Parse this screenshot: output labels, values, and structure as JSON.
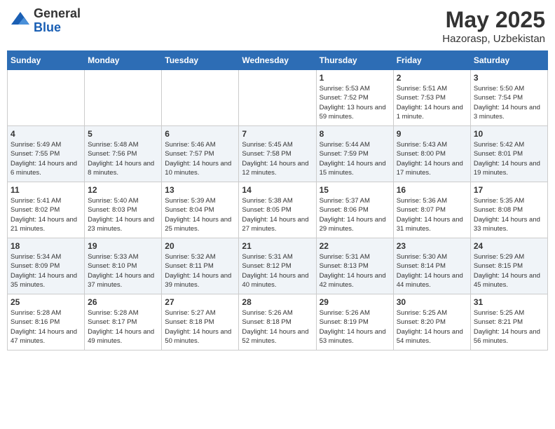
{
  "logo": {
    "general": "General",
    "blue": "Blue"
  },
  "header": {
    "month": "May 2025",
    "location": "Hazorasp, Uzbekistan"
  },
  "days_of_week": [
    "Sunday",
    "Monday",
    "Tuesday",
    "Wednesday",
    "Thursday",
    "Friday",
    "Saturday"
  ],
  "weeks": [
    {
      "days": [
        {
          "num": "",
          "info": ""
        },
        {
          "num": "",
          "info": ""
        },
        {
          "num": "",
          "info": ""
        },
        {
          "num": "",
          "info": ""
        },
        {
          "num": "1",
          "sunrise": "Sunrise: 5:53 AM",
          "sunset": "Sunset: 7:52 PM",
          "daylight": "Daylight: 13 hours and 59 minutes."
        },
        {
          "num": "2",
          "sunrise": "Sunrise: 5:51 AM",
          "sunset": "Sunset: 7:53 PM",
          "daylight": "Daylight: 14 hours and 1 minute."
        },
        {
          "num": "3",
          "sunrise": "Sunrise: 5:50 AM",
          "sunset": "Sunset: 7:54 PM",
          "daylight": "Daylight: 14 hours and 3 minutes."
        }
      ]
    },
    {
      "days": [
        {
          "num": "4",
          "sunrise": "Sunrise: 5:49 AM",
          "sunset": "Sunset: 7:55 PM",
          "daylight": "Daylight: 14 hours and 6 minutes."
        },
        {
          "num": "5",
          "sunrise": "Sunrise: 5:48 AM",
          "sunset": "Sunset: 7:56 PM",
          "daylight": "Daylight: 14 hours and 8 minutes."
        },
        {
          "num": "6",
          "sunrise": "Sunrise: 5:46 AM",
          "sunset": "Sunset: 7:57 PM",
          "daylight": "Daylight: 14 hours and 10 minutes."
        },
        {
          "num": "7",
          "sunrise": "Sunrise: 5:45 AM",
          "sunset": "Sunset: 7:58 PM",
          "daylight": "Daylight: 14 hours and 12 minutes."
        },
        {
          "num": "8",
          "sunrise": "Sunrise: 5:44 AM",
          "sunset": "Sunset: 7:59 PM",
          "daylight": "Daylight: 14 hours and 15 minutes."
        },
        {
          "num": "9",
          "sunrise": "Sunrise: 5:43 AM",
          "sunset": "Sunset: 8:00 PM",
          "daylight": "Daylight: 14 hours and 17 minutes."
        },
        {
          "num": "10",
          "sunrise": "Sunrise: 5:42 AM",
          "sunset": "Sunset: 8:01 PM",
          "daylight": "Daylight: 14 hours and 19 minutes."
        }
      ]
    },
    {
      "days": [
        {
          "num": "11",
          "sunrise": "Sunrise: 5:41 AM",
          "sunset": "Sunset: 8:02 PM",
          "daylight": "Daylight: 14 hours and 21 minutes."
        },
        {
          "num": "12",
          "sunrise": "Sunrise: 5:40 AM",
          "sunset": "Sunset: 8:03 PM",
          "daylight": "Daylight: 14 hours and 23 minutes."
        },
        {
          "num": "13",
          "sunrise": "Sunrise: 5:39 AM",
          "sunset": "Sunset: 8:04 PM",
          "daylight": "Daylight: 14 hours and 25 minutes."
        },
        {
          "num": "14",
          "sunrise": "Sunrise: 5:38 AM",
          "sunset": "Sunset: 8:05 PM",
          "daylight": "Daylight: 14 hours and 27 minutes."
        },
        {
          "num": "15",
          "sunrise": "Sunrise: 5:37 AM",
          "sunset": "Sunset: 8:06 PM",
          "daylight": "Daylight: 14 hours and 29 minutes."
        },
        {
          "num": "16",
          "sunrise": "Sunrise: 5:36 AM",
          "sunset": "Sunset: 8:07 PM",
          "daylight": "Daylight: 14 hours and 31 minutes."
        },
        {
          "num": "17",
          "sunrise": "Sunrise: 5:35 AM",
          "sunset": "Sunset: 8:08 PM",
          "daylight": "Daylight: 14 hours and 33 minutes."
        }
      ]
    },
    {
      "days": [
        {
          "num": "18",
          "sunrise": "Sunrise: 5:34 AM",
          "sunset": "Sunset: 8:09 PM",
          "daylight": "Daylight: 14 hours and 35 minutes."
        },
        {
          "num": "19",
          "sunrise": "Sunrise: 5:33 AM",
          "sunset": "Sunset: 8:10 PM",
          "daylight": "Daylight: 14 hours and 37 minutes."
        },
        {
          "num": "20",
          "sunrise": "Sunrise: 5:32 AM",
          "sunset": "Sunset: 8:11 PM",
          "daylight": "Daylight: 14 hours and 39 minutes."
        },
        {
          "num": "21",
          "sunrise": "Sunrise: 5:31 AM",
          "sunset": "Sunset: 8:12 PM",
          "daylight": "Daylight: 14 hours and 40 minutes."
        },
        {
          "num": "22",
          "sunrise": "Sunrise: 5:31 AM",
          "sunset": "Sunset: 8:13 PM",
          "daylight": "Daylight: 14 hours and 42 minutes."
        },
        {
          "num": "23",
          "sunrise": "Sunrise: 5:30 AM",
          "sunset": "Sunset: 8:14 PM",
          "daylight": "Daylight: 14 hours and 44 minutes."
        },
        {
          "num": "24",
          "sunrise": "Sunrise: 5:29 AM",
          "sunset": "Sunset: 8:15 PM",
          "daylight": "Daylight: 14 hours and 45 minutes."
        }
      ]
    },
    {
      "days": [
        {
          "num": "25",
          "sunrise": "Sunrise: 5:28 AM",
          "sunset": "Sunset: 8:16 PM",
          "daylight": "Daylight: 14 hours and 47 minutes."
        },
        {
          "num": "26",
          "sunrise": "Sunrise: 5:28 AM",
          "sunset": "Sunset: 8:17 PM",
          "daylight": "Daylight: 14 hours and 49 minutes."
        },
        {
          "num": "27",
          "sunrise": "Sunrise: 5:27 AM",
          "sunset": "Sunset: 8:18 PM",
          "daylight": "Daylight: 14 hours and 50 minutes."
        },
        {
          "num": "28",
          "sunrise": "Sunrise: 5:26 AM",
          "sunset": "Sunset: 8:18 PM",
          "daylight": "Daylight: 14 hours and 52 minutes."
        },
        {
          "num": "29",
          "sunrise": "Sunrise: 5:26 AM",
          "sunset": "Sunset: 8:19 PM",
          "daylight": "Daylight: 14 hours and 53 minutes."
        },
        {
          "num": "30",
          "sunrise": "Sunrise: 5:25 AM",
          "sunset": "Sunset: 8:20 PM",
          "daylight": "Daylight: 14 hours and 54 minutes."
        },
        {
          "num": "31",
          "sunrise": "Sunrise: 5:25 AM",
          "sunset": "Sunset: 8:21 PM",
          "daylight": "Daylight: 14 hours and 56 minutes."
        }
      ]
    }
  ]
}
